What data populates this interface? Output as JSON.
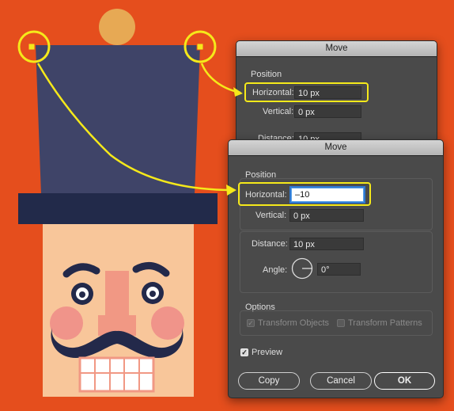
{
  "colors": {
    "background": "#e54e1d",
    "hat": "#3f4468",
    "hat_brim": "#222a4a",
    "pompom": "#e7a954",
    "face": "#f8c69a",
    "cheeks": "#f0948a",
    "nose": "#f19884",
    "mustache": "#23294a",
    "highlight": "#f5e91a",
    "dialog": "#4a4a4a"
  },
  "dialog_back": {
    "title": "Move",
    "position_heading": "Position",
    "horizontal_label": "Horizontal:",
    "horizontal_value": "10 px",
    "vertical_label": "Vertical:",
    "vertical_value": "0 px",
    "distance_label": "Distance:",
    "distance_value": "10 px"
  },
  "dialog_front": {
    "title": "Move",
    "position_heading": "Position",
    "horizontal_label": "Horizontal:",
    "horizontal_value": "–10",
    "vertical_label": "Vertical:",
    "vertical_value": "0 px",
    "distance_label": "Distance:",
    "distance_value": "10 px",
    "angle_label": "Angle:",
    "angle_value": "0°",
    "options_heading": "Options",
    "transform_objects": "Transform Objects",
    "transform_patterns": "Transform Patterns",
    "preview_label": "Preview",
    "copy_button": "Copy",
    "cancel_button": "Cancel",
    "ok_button": "OK"
  }
}
